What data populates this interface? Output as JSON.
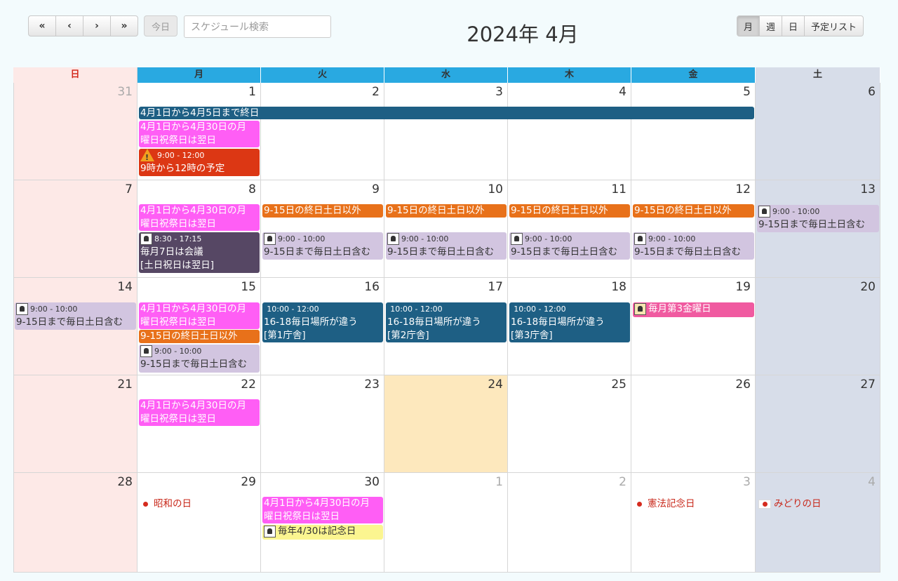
{
  "toolbar": {
    "first": "«",
    "prev": "‹",
    "next": "›",
    "last": "»",
    "today": "今日",
    "search_placeholder": "スケジュール検索",
    "title": "2024年 4月",
    "views": [
      "月",
      "週",
      "日",
      "予定リスト"
    ]
  },
  "weekdays": [
    "日",
    "月",
    "火",
    "水",
    "木",
    "金",
    "土"
  ],
  "weekday_colors": {
    "sun_bg": "#fde9e7",
    "sun_text": "#d32a1e",
    "weekday_bg": "#29a9e1",
    "sat_bg": "#d7dde9"
  },
  "days": [
    [
      "31",
      "1",
      "2",
      "3",
      "4",
      "5",
      "6"
    ],
    [
      "7",
      "8",
      "9",
      "10",
      "11",
      "12",
      "13"
    ],
    [
      "14",
      "15",
      "16",
      "17",
      "18",
      "19",
      "20"
    ],
    [
      "21",
      "22",
      "23",
      "24",
      "25",
      "26",
      "27"
    ],
    [
      "28",
      "29",
      "30",
      "1",
      "2",
      "3",
      "4"
    ]
  ],
  "events": {
    "span_1_5": "4月1日から4月5日まで終日",
    "monthly_holiday": "4月1日から4月30日の月曜日祝祭日は翌日",
    "monthly_holiday_a": "4月1日から4月30日の月",
    "monthly_holiday_b": "曜日祝祭日は翌日",
    "warn_time": "9:00 - 12:00",
    "warn_title": "9時から12時の予定",
    "meeting_time": "8:30 - 17:15",
    "meeting_title_a": "毎月7日は会議",
    "meeting_title_b": "[土日祝日は翌日]",
    "weekday_only": "9-15日の終日土日以外",
    "daily_time": "9:00 - 10:00",
    "daily_title": "9-15日まで毎日土日含む",
    "place_time": "10:00 - 12:00",
    "place_title": "16-18毎日場所が違う",
    "place_1": "[第1庁舎]",
    "place_2": "[第2庁舎]",
    "place_3": "[第3庁舎]",
    "third_friday": "毎月第3金曜日",
    "anniv": "毎年4/30は記念日",
    "showa": "昭和の日",
    "kenpo": "憲法記念日",
    "midori": "みどりの日"
  },
  "colors": {
    "navy": "#1e5f84",
    "magenta": "#ff5ef5",
    "red": "#dc3714",
    "dark_purple": "#564764",
    "orange": "#e8711a",
    "lavender": "#d2c5e0",
    "pink": "#f05aa0",
    "yellow": "#fbf590",
    "today": "#fde8bd"
  }
}
